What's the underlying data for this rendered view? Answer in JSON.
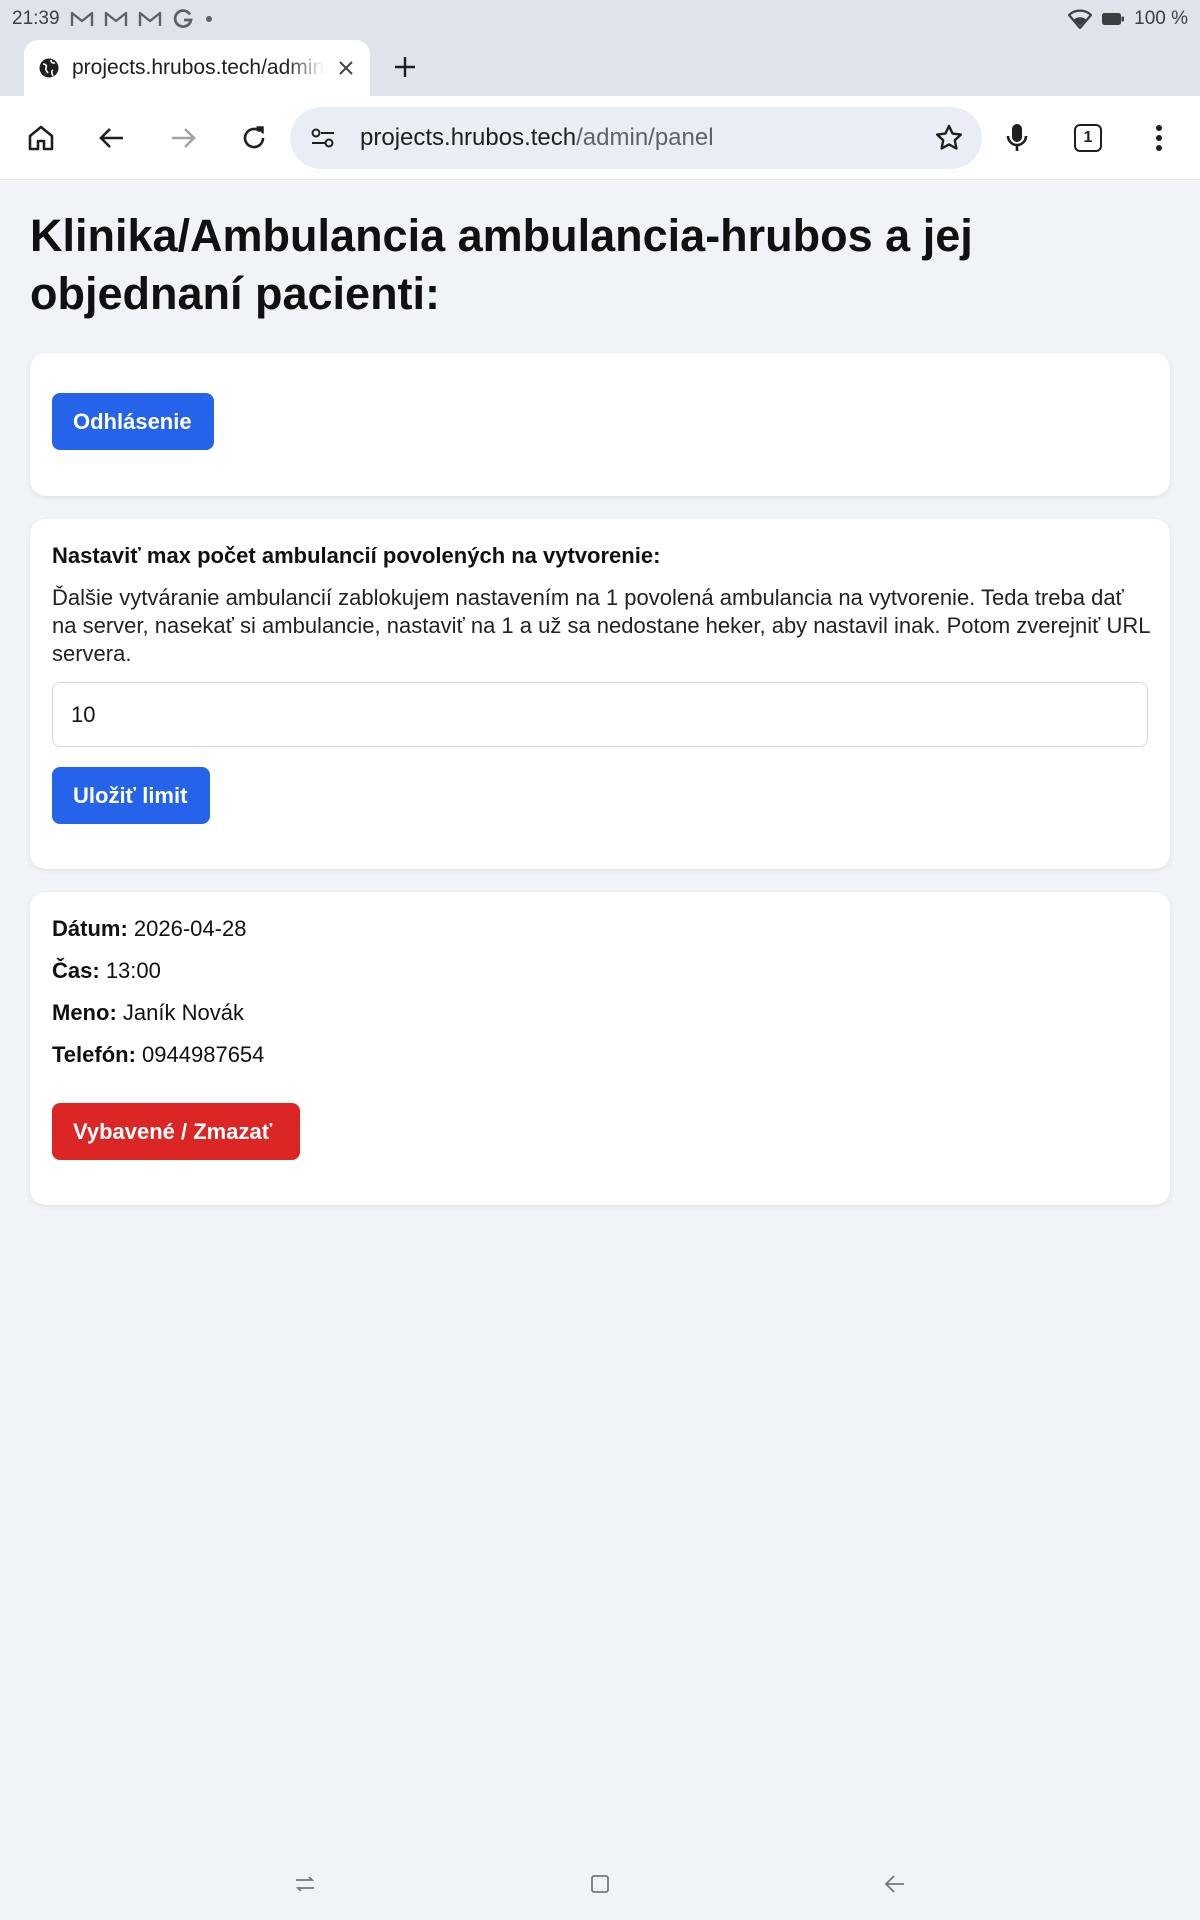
{
  "status_bar": {
    "time": "21:39",
    "battery": "100 %",
    "notification_icons": [
      "gmail-icon",
      "gmail-icon",
      "gmail-icon",
      "google-icon",
      "dot-icon"
    ]
  },
  "tab": {
    "title": "projects.hrubos.tech/admin/panel"
  },
  "omnibox": {
    "host": "projects.hrubos.tech",
    "path": "/admin/panel"
  },
  "toolbar": {
    "tab_count": "1"
  },
  "page": {
    "title": "Klinika/Ambulancia ambulancia-hrubos a jej objednaní pacienti:",
    "logout_label": "Odhlásenie",
    "limit_card": {
      "heading": "Nastaviť max počet ambulancií povolených na vytvorenie:",
      "description": "Ďalšie vytváranie ambulancií zablokujem nastavením na 1 povolená ambulancia na vytvorenie. Teda treba dať na server, nasekať si ambulancie, nastaviť na 1 a už sa nedostane heker, aby nastavil inak. Potom zverejniť URL servera.",
      "input_value": "10",
      "save_label": "Uložiť limit"
    },
    "appointment": {
      "date_label": "Dátum:",
      "date_value": "2026-04-28",
      "time_label": "Čas:",
      "time_value": "13:00",
      "name_label": "Meno:",
      "name_value": "Janík Novák",
      "phone_label": "Telefón:",
      "phone_value": "0944987654",
      "delete_label": "Vybavené / Zmazať"
    }
  },
  "colors": {
    "primary_button": "#2563eb",
    "danger_button": "#dc2626",
    "page_background": "#f0f4f9",
    "card_background": "#ffffff"
  }
}
